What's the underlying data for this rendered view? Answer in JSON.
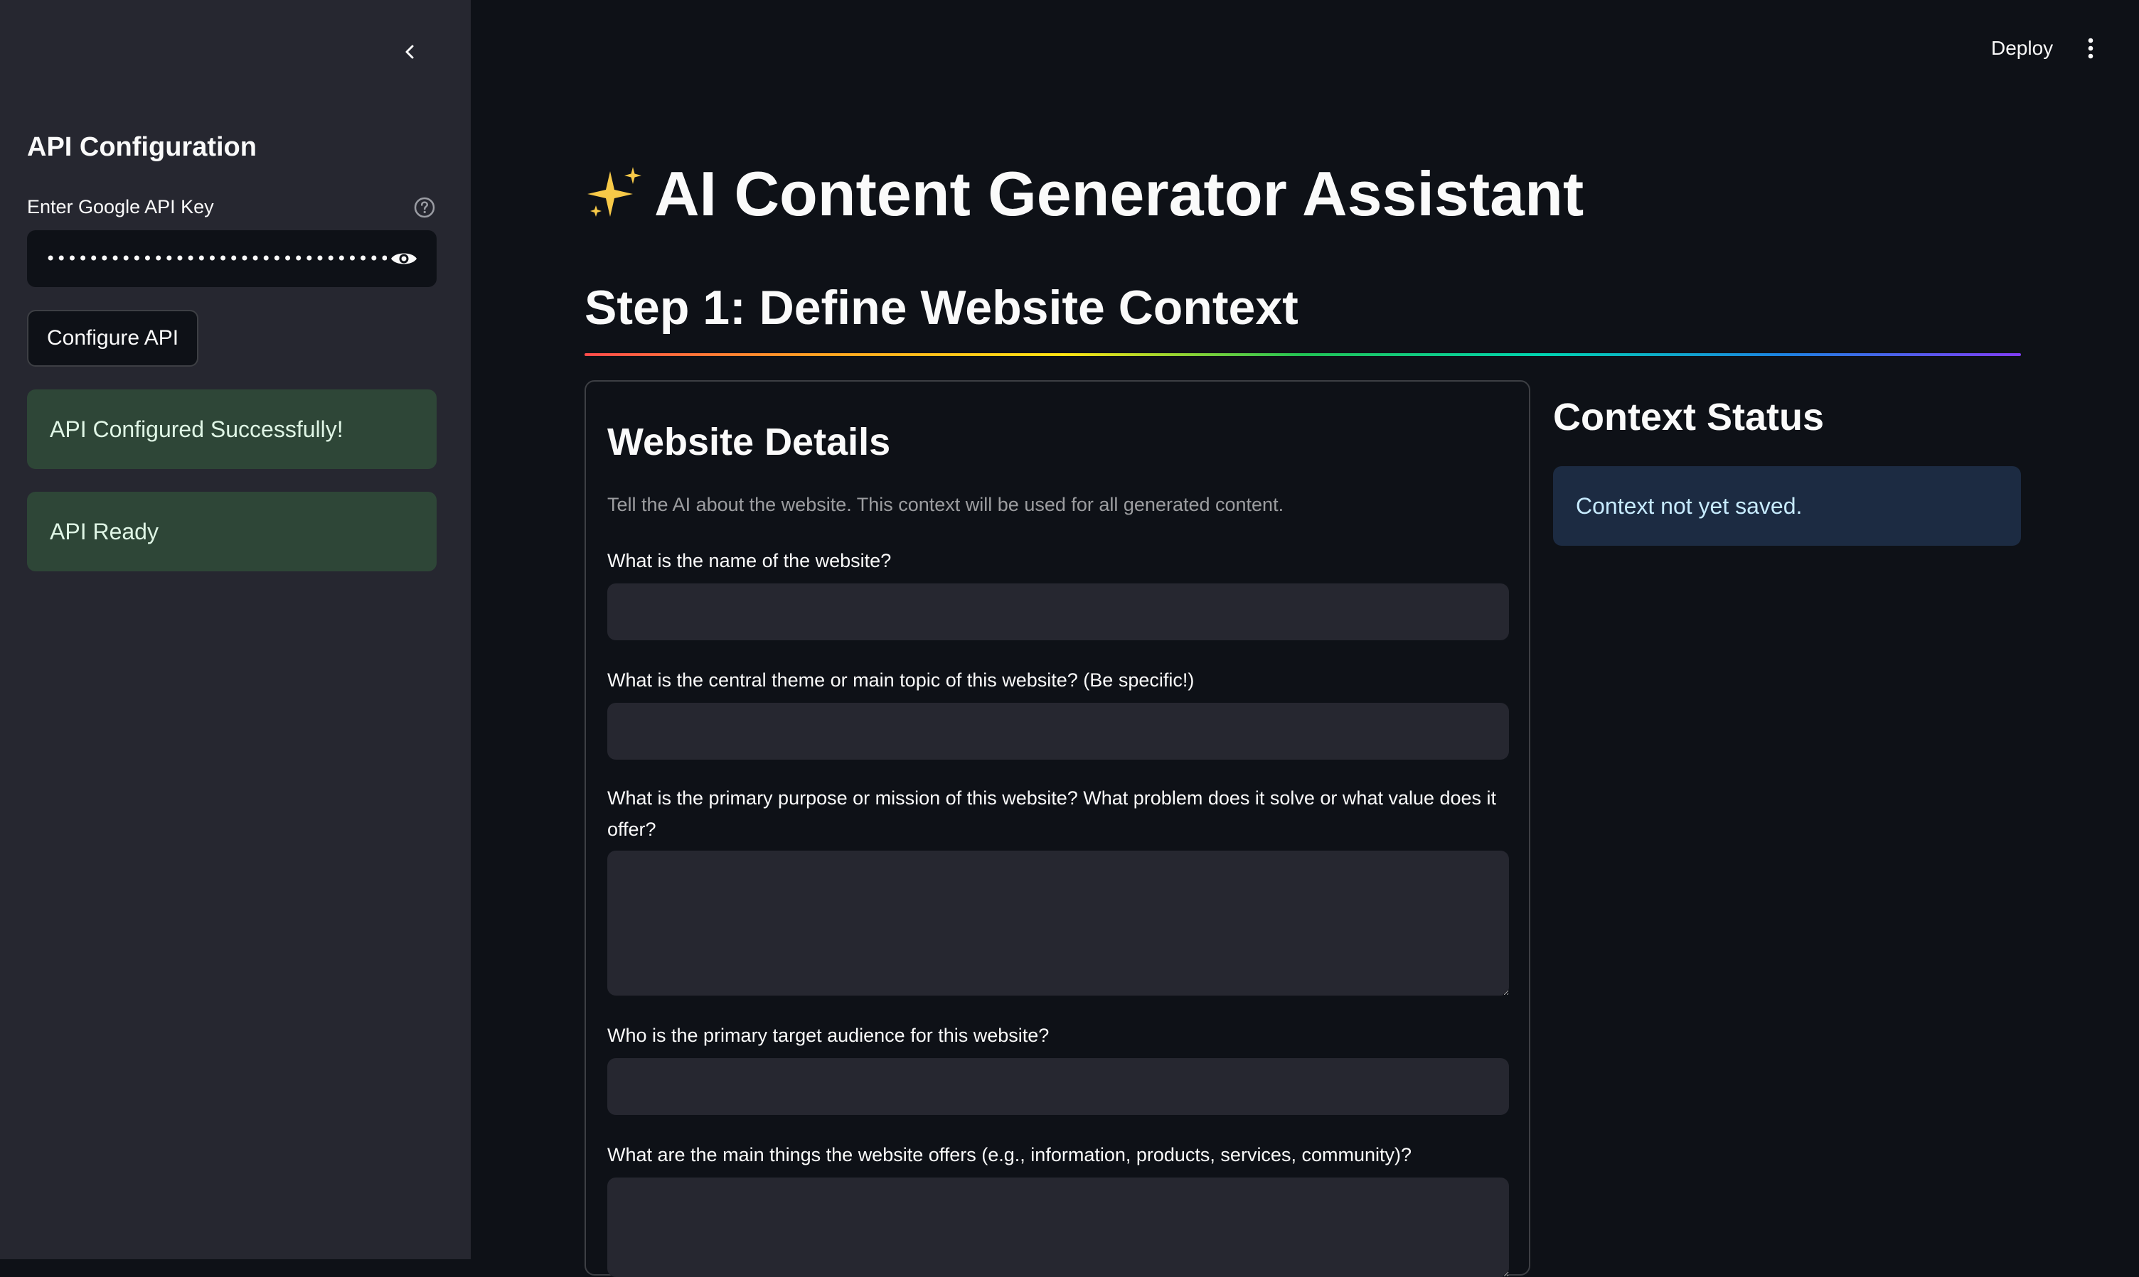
{
  "sidebar": {
    "collapse_icon": "chevron-left-icon",
    "title": "API Configuration",
    "api_key_label": "Enter Google API Key",
    "api_key_value": "••••••••••••••••••••••••••••••••••••••",
    "help_icon": "question-circle-icon",
    "reveal_icon": "eye-icon",
    "configure_button": "Configure API",
    "success_message": "API Configured Successfully!",
    "ready_message": "API Ready",
    "colors": {
      "background": "#262730",
      "success_bg": "#2e4637"
    }
  },
  "header": {
    "deploy_label": "Deploy",
    "menu_icon": "vertical-dots-icon"
  },
  "main": {
    "title_icon": "sparkles-icon",
    "title": "AI Content Generator Assistant",
    "step_heading": "Step 1: Define Website Context",
    "form": {
      "title": "Website Details",
      "caption": "Tell the AI about the website. This context will be used for all generated content.",
      "questions": [
        {
          "label": "What is the name of the website?",
          "value": ""
        },
        {
          "label": "What is the central theme or main topic of this website? (Be specific!)",
          "value": ""
        },
        {
          "label": "What is the primary purpose or mission of this website? What problem does it solve or what value does it offer?",
          "value": ""
        },
        {
          "label": "Who is the primary target audience for this website?",
          "value": ""
        },
        {
          "label": "What are the main things the website offers (e.g., information, products, services, community)?",
          "value": ""
        }
      ]
    },
    "context_status": {
      "title": "Context Status",
      "message": "Context not yet saved.",
      "info_bg": "#1c2b42"
    }
  },
  "colors": {
    "app_background": "#0e1117",
    "text": "#fafafa"
  }
}
